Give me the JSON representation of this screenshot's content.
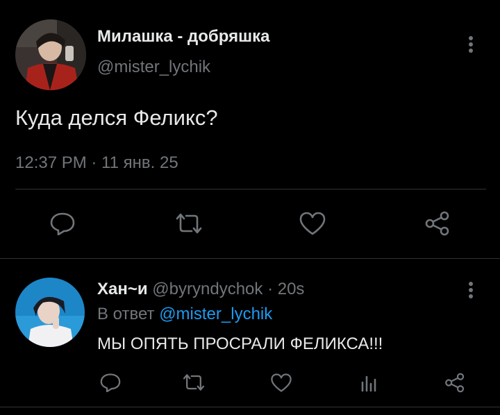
{
  "main_tweet": {
    "display_name": "Милашка - добряшка",
    "handle": "@mister_lychik",
    "text": "Куда делся Феликс?",
    "timestamp": "12:37 PM · 11 янв. 25",
    "actions": [
      "reply-icon",
      "retweet-icon",
      "like-icon",
      "share-icon"
    ]
  },
  "reply": {
    "display_name": "Хан~и",
    "handle": "@byryndychok",
    "separator": "·",
    "time_ago": "20s",
    "replying_prefix": "В ответ",
    "replying_to": "@mister_lychik",
    "text": "МЫ ОПЯТЬ ПРОСРАЛИ ФЕЛИКСА!!!",
    "actions": [
      "reply-icon",
      "retweet-icon",
      "like-icon",
      "analytics-icon",
      "share-icon"
    ]
  },
  "colors": {
    "background": "#000000",
    "text": "#e7e9ea",
    "secondary": "#71767b",
    "accent": "#1d9bf0",
    "divider": "#2f3336"
  }
}
